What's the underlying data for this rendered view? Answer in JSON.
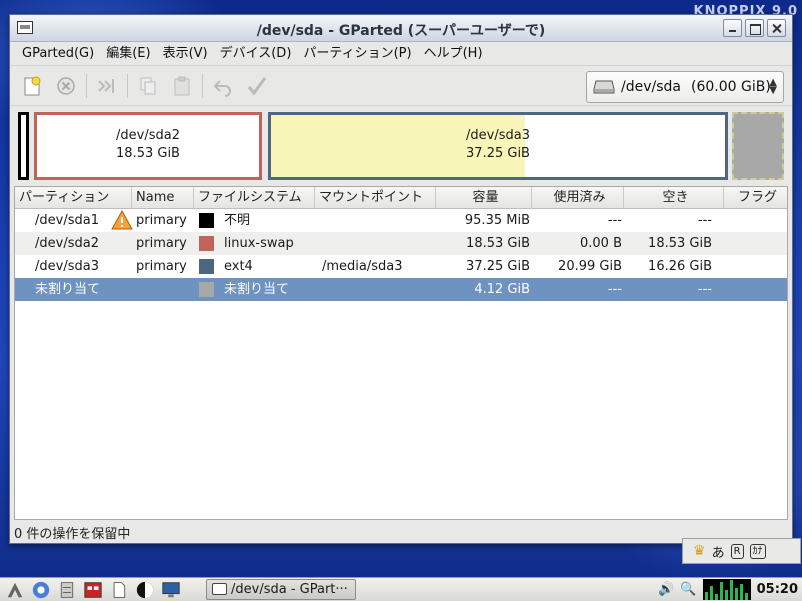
{
  "window": {
    "title": "/dev/sda - GParted (スーパーユーザーで)"
  },
  "menu": [
    "GParted(G)",
    "編集(E)",
    "表示(V)",
    "デバイス(D)",
    "パーティション(P)",
    "ヘルプ(H)"
  ],
  "toolbar": {
    "buttons": [
      "new-partition",
      "delete-partition",
      "resize-move",
      "copy",
      "paste",
      "undo",
      "apply"
    ],
    "device": {
      "name": "/dev/sda",
      "size": "(60.00 GiB)"
    }
  },
  "disk_map": {
    "swap": {
      "device": "/dev/sda2",
      "size": "18.53 GiB",
      "color": "#c0635b"
    },
    "ext4": {
      "device": "/dev/sda3",
      "size": "37.25 GiB",
      "color": "#4f6680",
      "used_fraction": 0.56
    },
    "unknown_color": "#000000",
    "unallocated_color": "#a8a8a8"
  },
  "table": {
    "headers": [
      "パーティション",
      "Name",
      "ファイルシステム",
      "マウントポイント",
      "容量",
      "使用済み",
      "空き",
      "フラグ"
    ],
    "rows": [
      {
        "partition": "/dev/sda1",
        "name": "primary",
        "fs": "不明",
        "fs_color": "#000000",
        "mount": "",
        "size": "95.35 MiB",
        "used": "---",
        "free": "---",
        "flags": "",
        "warning": true
      },
      {
        "partition": "/dev/sda2",
        "name": "primary",
        "fs": "linux-swap",
        "fs_color": "#c0635b",
        "mount": "",
        "size": "18.53 GiB",
        "used": "0.00 B",
        "free": "18.53 GiB",
        "flags": ""
      },
      {
        "partition": "/dev/sda3",
        "name": "primary",
        "fs": "ext4",
        "fs_color": "#4f6680",
        "mount": "/media/sda3",
        "size": "37.25 GiB",
        "used": "20.99 GiB",
        "free": "16.26 GiB",
        "flags": ""
      },
      {
        "partition": "未割り当て",
        "name": "",
        "fs": "未割り当て",
        "fs_color": "#a8a8a8",
        "mount": "",
        "size": "4.12 GiB",
        "used": "---",
        "free": "---",
        "flags": "",
        "selected": true
      }
    ]
  },
  "status": "0 件の操作を保留中",
  "ime": {
    "hiragana": "あ",
    "r_label": "R",
    "small_label": "ｶﾅ"
  },
  "taskbar": {
    "active_task": "/dev/sda - GPart···",
    "clock": "05:20"
  },
  "desktop": {
    "logo_text": "KNOPPIX 9.0"
  }
}
